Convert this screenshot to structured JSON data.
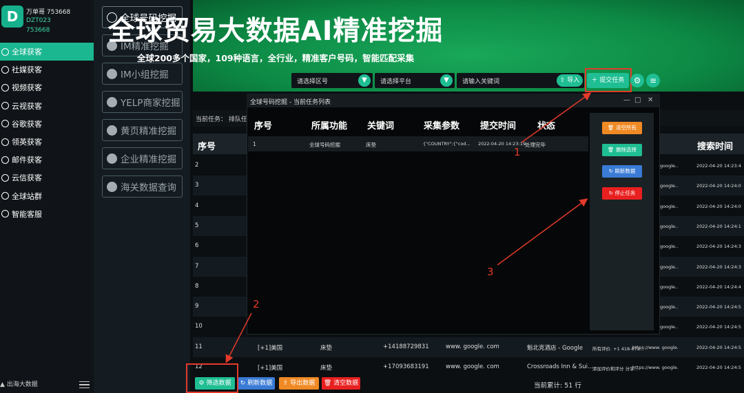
{
  "account": {
    "name": "万单哥 753668",
    "line2": "DZT023",
    "line3": "753668",
    "logo_letter": "D"
  },
  "left_nav": [
    {
      "label": "全球获客",
      "icon": "chat-bubble-icon",
      "active": true
    },
    {
      "label": "社媒获客",
      "icon": "social-icon",
      "active": false
    },
    {
      "label": "视频获客",
      "icon": "video-icon",
      "active": false
    },
    {
      "label": "云视获客",
      "icon": "cloud-video-icon",
      "active": false
    },
    {
      "label": "谷歌获客",
      "icon": "google-icon",
      "active": false
    },
    {
      "label": "领英获客",
      "icon": "linkedin-icon",
      "active": false
    },
    {
      "label": "邮件获客",
      "icon": "mail-icon",
      "active": false
    },
    {
      "label": "云信获客",
      "icon": "cloud-message-icon",
      "active": false
    },
    {
      "label": "全球站群",
      "icon": "globe-icon",
      "active": false
    },
    {
      "label": "智能客服",
      "icon": "headset-icon",
      "active": false
    }
  ],
  "bottom_brand": "出海大数据",
  "sub_nav": [
    {
      "label": "全球号码挖掘",
      "active": true
    },
    {
      "label": "IM精准挖掘",
      "active": false
    },
    {
      "label": "IM小组挖掘",
      "active": false
    },
    {
      "label": "YELP商家挖掘",
      "active": false
    },
    {
      "label": "黄页精准挖掘",
      "active": false
    },
    {
      "label": "企业精准挖掘",
      "active": false
    },
    {
      "label": "海关数据查询",
      "active": false
    }
  ],
  "banner": {
    "title": "全球贸易大数据AI精准挖掘",
    "subtitle": "全球200多个国家，109种语言，全行业，精准客户号码，智能匹配采集"
  },
  "search": {
    "region_placeholder": "请选择区号",
    "platform_placeholder": "请选择平台",
    "keyword_placeholder": "请输入关键词",
    "import_label": "导入",
    "submit_label": "提交任务"
  },
  "task_status": "当前任务：  排队任",
  "main_table": {
    "header_no": "序号",
    "header_time": "搜索时间",
    "rows": [
      {
        "no": "2",
        "src": "google..",
        "time": "2022-04-20 14:23:4"
      },
      {
        "no": "3",
        "src": "google..",
        "time": "2022-04-20 14:24:0"
      },
      {
        "no": "4",
        "src": "google..",
        "time": "2022-04-20 14:24:0"
      },
      {
        "no": "5",
        "src": "google..",
        "time": "2022-04-20 14:24:1"
      },
      {
        "no": "6",
        "src": "google..",
        "time": "2022-04-20 14:24:3"
      },
      {
        "no": "7",
        "src": "google..",
        "time": "2022-04-20 14:24:3"
      },
      {
        "no": "8",
        "src": "google..",
        "time": "2022-04-20 14:24:4"
      },
      {
        "no": "9",
        "src": "google..",
        "time": "2022-04-20 14:24:5"
      },
      {
        "no": "10",
        "src": "google..",
        "time": "2022-04-20 14:24:5"
      },
      {
        "no": "11",
        "country": "[+1]美国",
        "kw": "床垫",
        "phone": "+14188729831",
        "site": "www. google. com",
        "name": "魁北克酒店 - Google",
        "detail": "所有评价. +1 418-872...",
        "url": "https://www. google.",
        "time": "2022-04-20 14:24:5"
      },
      {
        "no": "12",
        "country": "[+1]美国",
        "kw": "床垫",
        "phone": "+17093683191",
        "site": "www. google. com",
        "name": "Crossroads Inn & Sui...",
        "detail": "添加评价和评分  分享...",
        "url": "https://www. google.",
        "time": "2022-04-20 14:24:5"
      }
    ]
  },
  "toolbar": {
    "filter_label": "筛选数据",
    "refresh_label": "刷新数据",
    "export_label": "导出数据",
    "clear_label": "清空数据",
    "total": "当前累计:  51  行"
  },
  "dialog": {
    "title": "全球号码挖掘 - 当前任务列表",
    "headers": [
      "序号",
      "所属功能",
      "关键词",
      "采集参数",
      "提交时间",
      "状态"
    ],
    "row": {
      "no": "1",
      "function": "全球号码挖掘",
      "keyword": "床垫",
      "params": "{\"COUNTRY\":{\"cod...",
      "time": "2022-04-20  14:23:19",
      "status": "处理完毕"
    },
    "buttons": {
      "clear_all": "清空所有",
      "delete_selected": "删除选择",
      "refresh": "刷新数据",
      "stop": "停止任务"
    }
  },
  "annotations": {
    "n1": "1",
    "n2": "2",
    "n3": "3"
  },
  "colors": {
    "accent": "#1fbe93",
    "annotation": "#e53a2b",
    "orange": "#f08a24",
    "blue": "#3a7bd5",
    "red": "#e8201f"
  }
}
